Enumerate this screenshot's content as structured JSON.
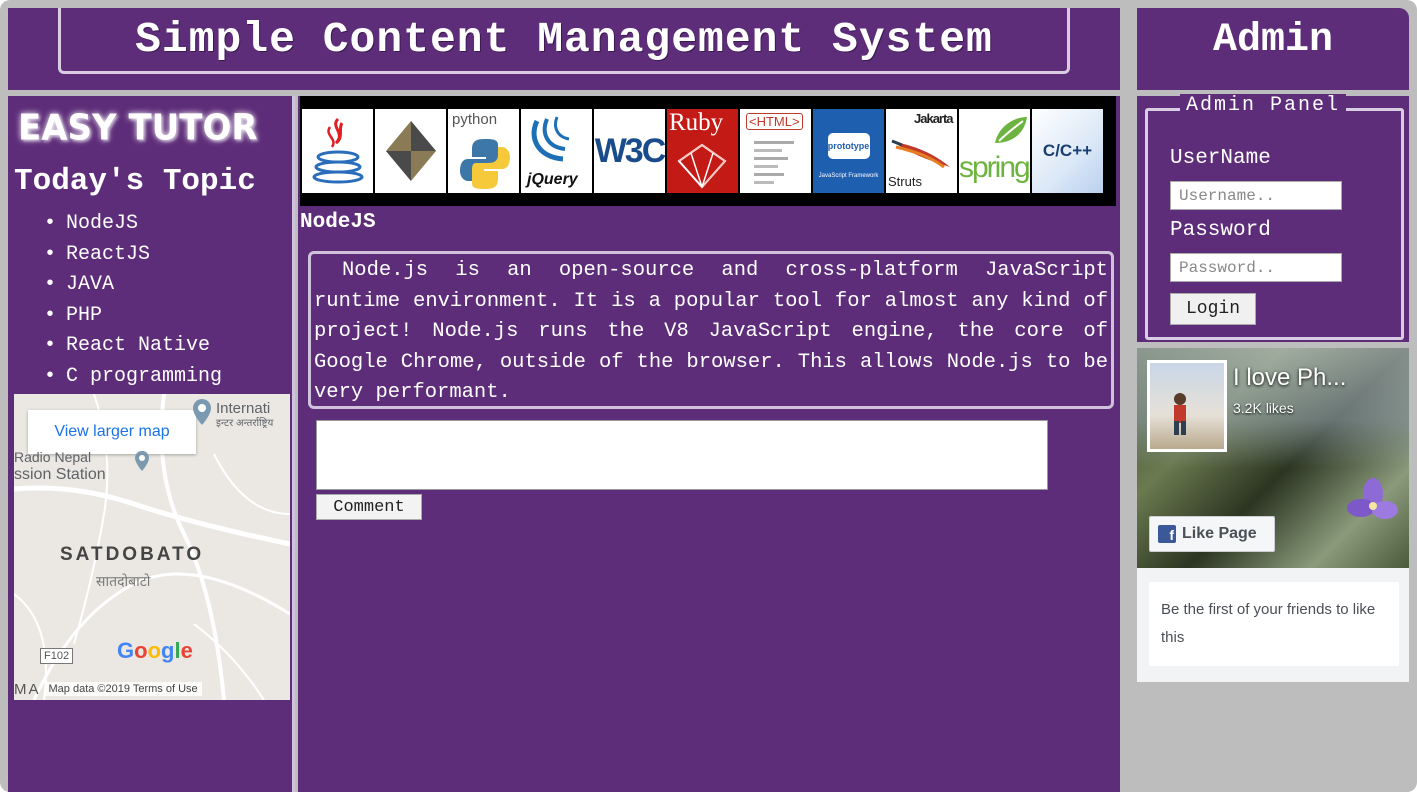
{
  "header": {
    "title": "Simple Content Management System",
    "admin_title": "Admin"
  },
  "sidebar": {
    "logo_text": "EASY TUTOR",
    "topics_heading": "Today's Topic",
    "topics": [
      "NodeJS",
      "ReactJS",
      "JAVA",
      "PHP",
      "React Native",
      "C programming"
    ]
  },
  "map": {
    "view_larger": "View larger map",
    "place_international": "Internati",
    "place_international_sub": "इन्टर अन्तर्राष्ट्रिय",
    "place_radio": "Radio Nepal",
    "place_station": "ssion Station",
    "area": "SATDOBATO",
    "area_sub": "सातदोबाटो",
    "road_sign": "F102",
    "google": [
      "G",
      "o",
      "o",
      "g",
      "l",
      "e"
    ],
    "corner": "MA",
    "attribution": "Map data ©2019    Terms of Use"
  },
  "banner": {
    "tiles": [
      {
        "name": "java",
        "label": ""
      },
      {
        "name": "cube",
        "label": ""
      },
      {
        "name": "python",
        "label": "python"
      },
      {
        "name": "jquery",
        "label": "jQuery"
      },
      {
        "name": "w3c",
        "label": "W3C"
      },
      {
        "name": "ruby",
        "label": "Ruby"
      },
      {
        "name": "html",
        "label": "<HTML>"
      },
      {
        "name": "prototype",
        "label": "prototype"
      },
      {
        "name": "struts",
        "label": "Jakarta"
      },
      {
        "name": "spring",
        "label": "spring"
      },
      {
        "name": "cpp",
        "label": "C/C++"
      }
    ],
    "struts_sub": "Struts",
    "prototype_sub": "JavaScript Framework"
  },
  "article": {
    "title": "NodeJS",
    "body": "Node.js is an open-source and cross-platform JavaScript runtime environment. It is a popular tool for almost any kind of project! Node.js runs the V8 JavaScript engine, the core of Google Chrome, outside of the browser. This allows Node.js to be very performant.",
    "comment_value": "",
    "comment_button": "Comment"
  },
  "admin": {
    "legend": "Admin Panel",
    "username_label": "UserName",
    "username_placeholder": "Username..",
    "password_label": "Password",
    "password_placeholder": "Password..",
    "login_button": "Login"
  },
  "facebook": {
    "page_name": "I love Ph...",
    "likes": "3.2K likes",
    "like_button": "Like Page",
    "friends_text": "Be the first of your friends to like this"
  },
  "colors": {
    "purple": "#5e2d79",
    "border": "#cfc3dc",
    "background": "#bdbdbd",
    "facebook": "#3b5998"
  }
}
